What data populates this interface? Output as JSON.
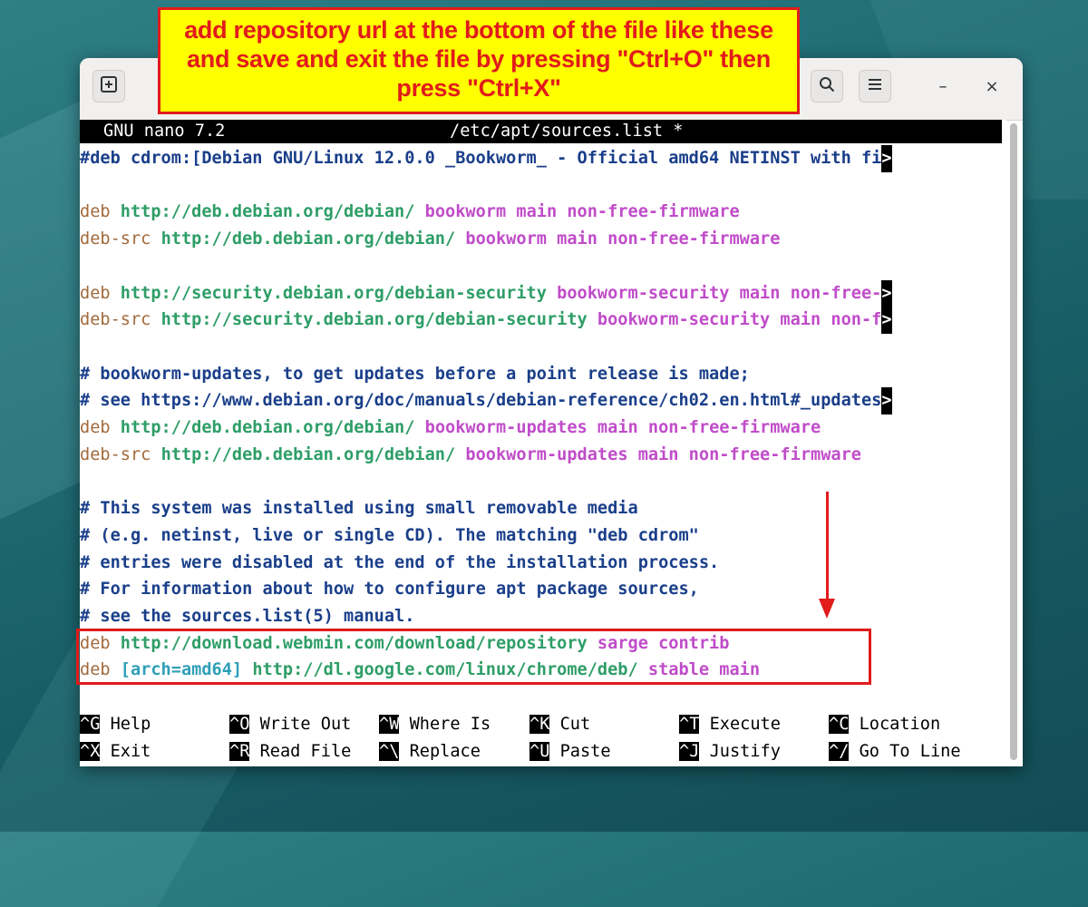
{
  "window": {
    "new_tab_icon": "plus-box-icon",
    "search_icon": "search-icon",
    "menu_icon": "hamburger-menu-icon",
    "minimize_label": "–",
    "close_label": "×"
  },
  "nano": {
    "version": "GNU nano 7.2",
    "filename": "/etc/apt/sources.list *",
    "lines": [
      {
        "parts": [
          {
            "t": "#deb cdrom:[Debian GNU/Linux 12.0.0 _Bookworm_ - Official amd64 NETINST with fi",
            "c": "comment"
          }
        ],
        "overflow": true
      },
      {
        "parts": []
      },
      {
        "parts": [
          {
            "t": "deb ",
            "c": "deb"
          },
          {
            "t": "http://deb.debian.org/debian/ ",
            "c": "url"
          },
          {
            "t": "bookworm main non-free-firmware",
            "c": "opt"
          }
        ]
      },
      {
        "parts": [
          {
            "t": "deb-src ",
            "c": "deb"
          },
          {
            "t": "http://deb.debian.org/debian/ ",
            "c": "url"
          },
          {
            "t": "bookworm main non-free-firmware",
            "c": "opt"
          }
        ]
      },
      {
        "parts": []
      },
      {
        "parts": [
          {
            "t": "deb ",
            "c": "deb"
          },
          {
            "t": "http://security.debian.org/debian-security ",
            "c": "url"
          },
          {
            "t": "bookworm-security main non-free-",
            "c": "opt"
          }
        ],
        "overflow": true
      },
      {
        "parts": [
          {
            "t": "deb-src ",
            "c": "deb"
          },
          {
            "t": "http://security.debian.org/debian-security ",
            "c": "url"
          },
          {
            "t": "bookworm-security main non-f",
            "c": "opt"
          }
        ],
        "overflow": true
      },
      {
        "parts": []
      },
      {
        "parts": [
          {
            "t": "# bookworm-updates, to get updates before a point release is made;",
            "c": "comment"
          }
        ]
      },
      {
        "parts": [
          {
            "t": "# see https://www.debian.org/doc/manuals/debian-reference/ch02.en.html#_updates",
            "c": "comment"
          }
        ],
        "overflow": true
      },
      {
        "parts": [
          {
            "t": "deb ",
            "c": "deb"
          },
          {
            "t": "http://deb.debian.org/debian/ ",
            "c": "url"
          },
          {
            "t": "bookworm-updates main non-free-firmware",
            "c": "opt"
          }
        ]
      },
      {
        "parts": [
          {
            "t": "deb-src ",
            "c": "deb"
          },
          {
            "t": "http://deb.debian.org/debian/ ",
            "c": "url"
          },
          {
            "t": "bookworm-updates main non-free-firmware",
            "c": "opt"
          }
        ]
      },
      {
        "parts": []
      },
      {
        "parts": [
          {
            "t": "# This system was installed using small removable media",
            "c": "comment"
          }
        ]
      },
      {
        "parts": [
          {
            "t": "# (e.g. netinst, live or single CD). The matching \"deb cdrom\"",
            "c": "comment"
          }
        ]
      },
      {
        "parts": [
          {
            "t": "# entries were disabled at the end of the installation process.",
            "c": "comment"
          }
        ]
      },
      {
        "parts": [
          {
            "t": "# For information about how to configure apt package sources,",
            "c": "comment"
          }
        ]
      },
      {
        "parts": [
          {
            "t": "# see the sources.list(5) manual.",
            "c": "comment"
          }
        ]
      },
      {
        "parts": [
          {
            "t": "deb ",
            "c": "deb"
          },
          {
            "t": "http://download.webmin.com/download/repository ",
            "c": "url"
          },
          {
            "t": "sarge contrib",
            "c": "opt"
          }
        ]
      },
      {
        "parts": [
          {
            "t": "deb ",
            "c": "deb"
          },
          {
            "t": "[arch=amd64] ",
            "c": "arch"
          },
          {
            "t": "http://dl.google.com/linux/chrome/deb/ ",
            "c": "url"
          },
          {
            "t": "stable main",
            "c": "opt"
          }
        ]
      }
    ],
    "overflow_marker": ">",
    "shortcuts_row1": [
      {
        "key": "^G",
        "label": "Help"
      },
      {
        "key": "^O",
        "label": "Write Out"
      },
      {
        "key": "^W",
        "label": "Where Is"
      },
      {
        "key": "^K",
        "label": "Cut"
      },
      {
        "key": "^T",
        "label": "Execute"
      },
      {
        "key": "^C",
        "label": "Location"
      }
    ],
    "shortcuts_row2": [
      {
        "key": "^X",
        "label": "Exit"
      },
      {
        "key": "^R",
        "label": "Read File"
      },
      {
        "key": "^\\",
        "label": "Replace"
      },
      {
        "key": "^U",
        "label": "Paste"
      },
      {
        "key": "^J",
        "label": "Justify"
      },
      {
        "key": "^/",
        "label": "Go To Line"
      }
    ]
  },
  "annotation": {
    "callout_lines": [
      "add repository url at the bottom of the file like these",
      "and save and exit the file by pressing \"Ctrl+O\" then",
      "press \"Ctrl+X\""
    ],
    "highlight_color": "#e21b1b",
    "callout_bg": "#ffff00"
  }
}
